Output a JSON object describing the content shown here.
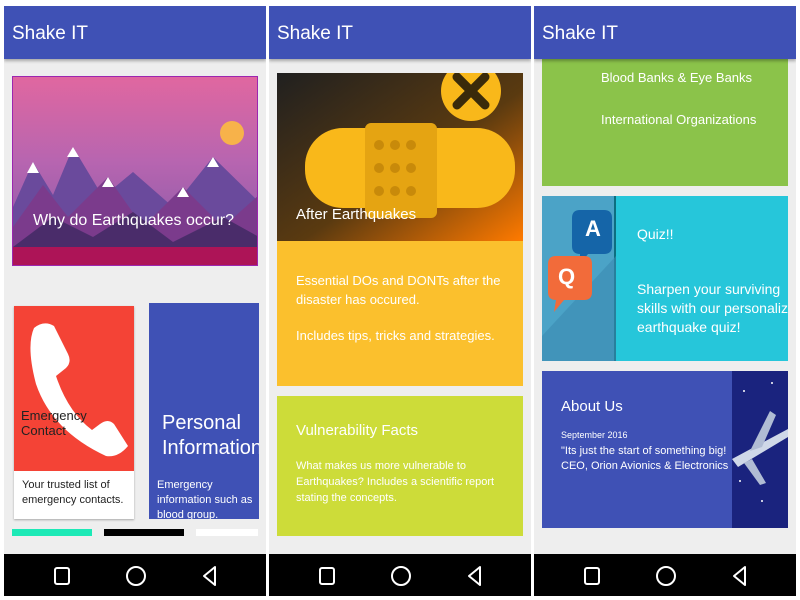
{
  "app": {
    "title": "Shake IT"
  },
  "screen1": {
    "hero_title": "Why do Earthquakes occur?",
    "emergency": {
      "title": "Emergency Contact",
      "desc": "Your trusted list of emergency contacts."
    },
    "personal": {
      "title": "Personal Information",
      "desc": "Emergency information such as blood group."
    }
  },
  "screen2": {
    "after": {
      "title": "After Earthquakes",
      "desc1": "Essential DOs and DONTs after the disaster has occured.",
      "desc2": "Includes tips, tricks and strategies."
    },
    "vulnerability": {
      "title": "Vulnerability Facts",
      "desc": "What makes us more vulnerable to Earthquakes? Includes a scientific report stating the concepts."
    }
  },
  "screen3": {
    "orgs": {
      "item1": "Blood Banks & Eye Banks",
      "item2": "International Organizations"
    },
    "quiz": {
      "title": "Quiz!!",
      "desc": "Sharpen your surviving skills with our personalized earthquake quiz!",
      "icon_a": "A",
      "icon_q": "Q"
    },
    "about": {
      "title": "About Us",
      "date": "September 2016",
      "quote": "\"Its just the start of something big! CEO, Orion Avionics & Electronics"
    }
  },
  "colors": {
    "appbar": "#3f51b5",
    "red": "#f44336",
    "indigo": "#3f51b5",
    "amber": "#fbc02d",
    "lime": "#cddc39",
    "green": "#8bc34a",
    "cyan": "#26c6da",
    "maroon": "#ad1457"
  },
  "icons": [
    "square-nav-icon",
    "circle-nav-icon",
    "triangle-nav-icon",
    "phone-icon",
    "close-icon",
    "qa-bubble-icon",
    "airplane-icon",
    "mountains-illustration"
  ]
}
